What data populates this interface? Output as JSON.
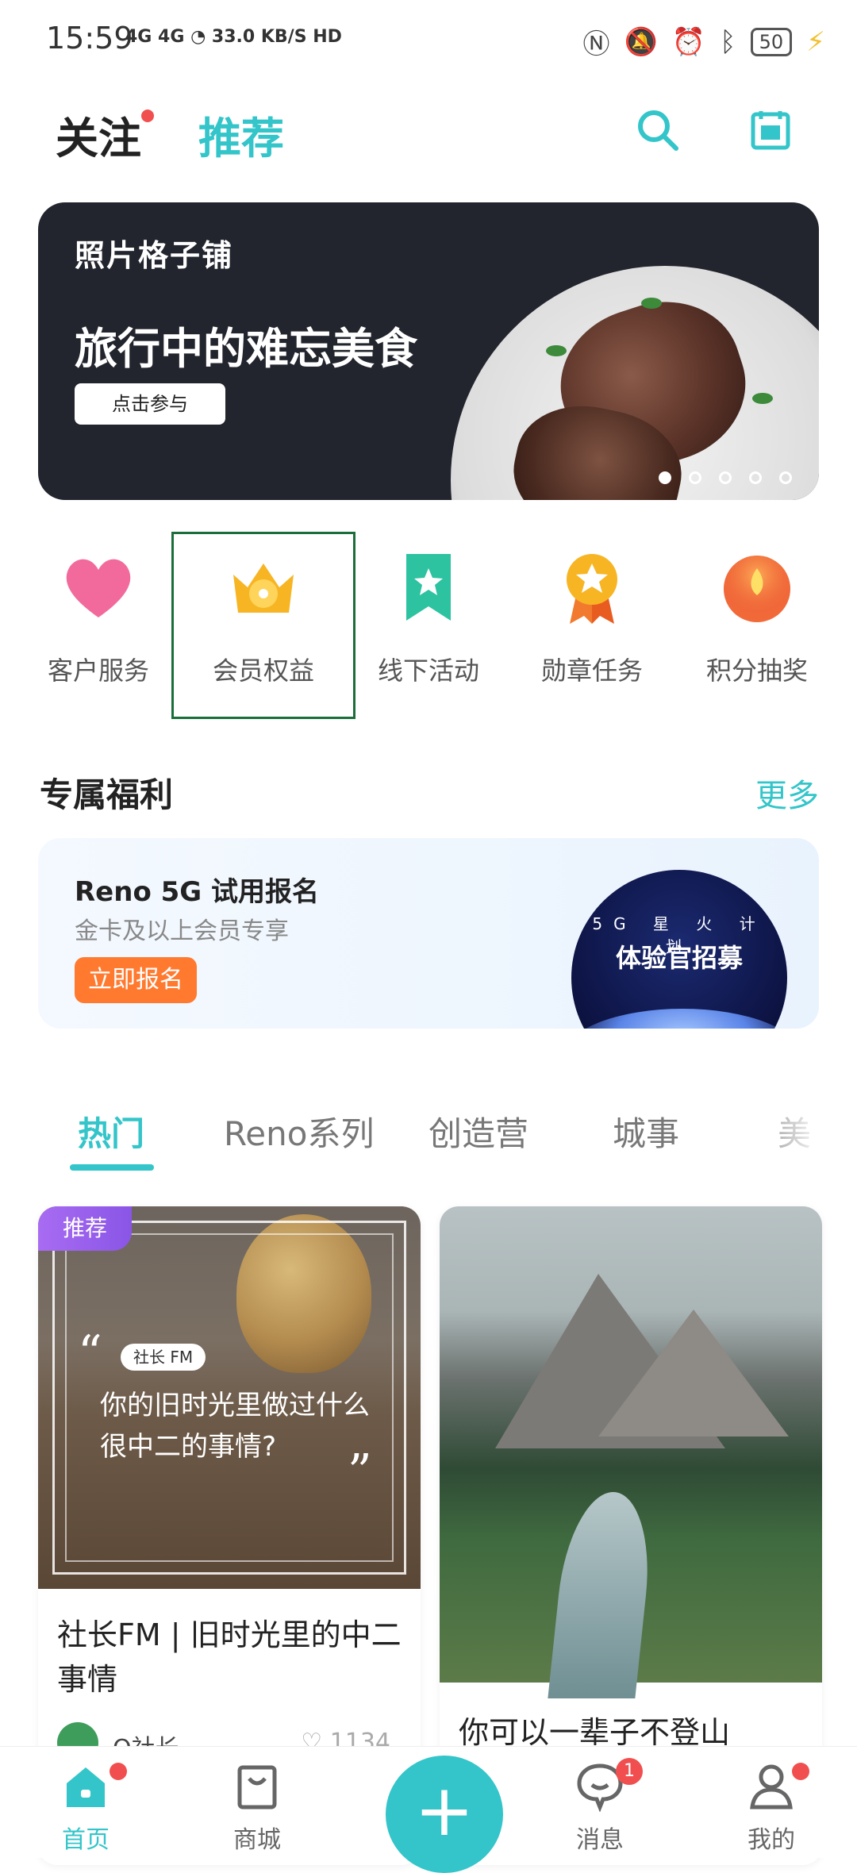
{
  "status_bar": {
    "time": "15:59",
    "network": "4G 4G",
    "speed": "33.0 KB/S",
    "hd": "HD",
    "battery": "50"
  },
  "top_nav": {
    "follow_label": "关注",
    "recommend_label": "推荐"
  },
  "banner": {
    "brand": "照片格子铺",
    "title": "旅行中的难忘美食",
    "button": "点击参与",
    "page_count": 5,
    "active_index": 0
  },
  "quick_actions": [
    {
      "label": "客户服务",
      "icon": "heart-icon"
    },
    {
      "label": "会员权益",
      "icon": "crown-icon"
    },
    {
      "label": "线下活动",
      "icon": "bookmark-star-icon"
    },
    {
      "label": "勋章任务",
      "icon": "medal-icon"
    },
    {
      "label": "积分抽奖",
      "icon": "flame-icon"
    }
  ],
  "exclusive": {
    "title": "专属福利",
    "more": "更多",
    "promo_title": "Reno 5G 试用报名",
    "promo_sub": "金卡及以上会员专享",
    "promo_btn": "立即报名",
    "planet_line1": "5G 星 火 计 划",
    "planet_line2": "体验官招募"
  },
  "tabs": [
    "热门",
    "Reno系列",
    "创造营",
    "城事",
    "美"
  ],
  "cards": {
    "card1": {
      "tag": "推荐",
      "chip": "社长 FM",
      "quote": "你的旧时光里做过什么很中二的事情?",
      "title": "社长FM | 旧时光里的中二事情",
      "author": "O社长",
      "likes": "1134"
    },
    "card2": {
      "title": "你可以一辈子不登山"
    }
  },
  "bottom_nav": {
    "home": "首页",
    "mall": "商城",
    "messages": "消息",
    "messages_badge": "1",
    "mine": "我的"
  },
  "colors": {
    "accent": "#33c5c9",
    "badge": "#f14f4f",
    "promo_button": "#ff7a2f",
    "tag_purple": "#8a55e6"
  }
}
